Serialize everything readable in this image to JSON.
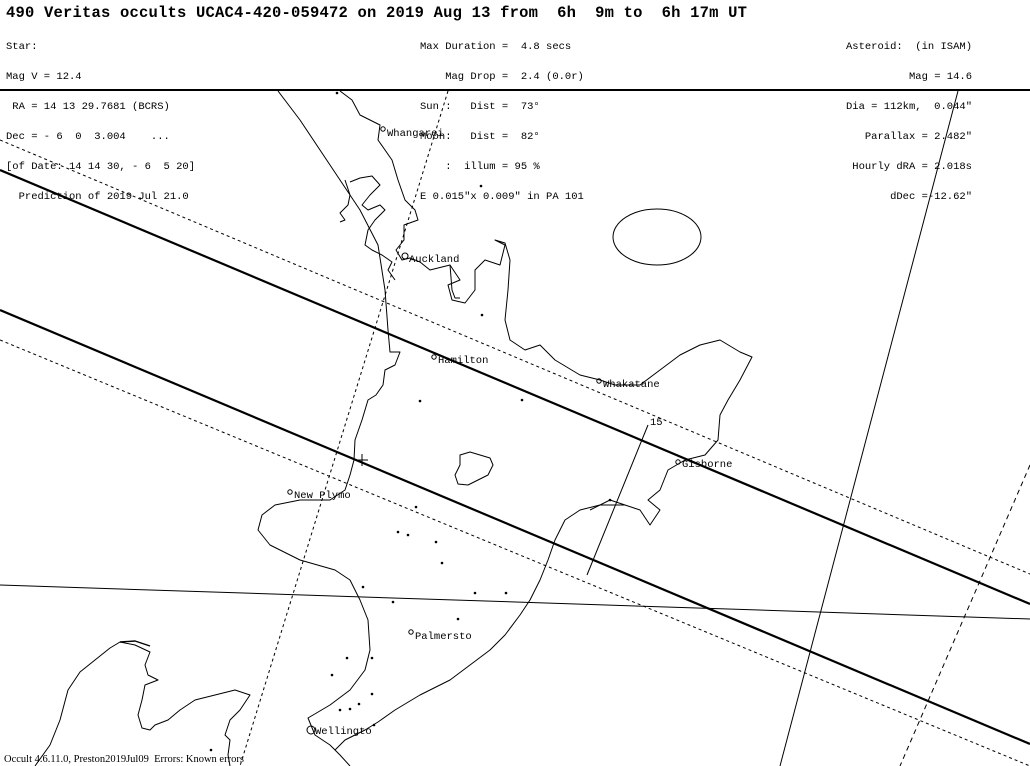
{
  "title": "490 Veritas occults UCAC4-420-059472 on 2019 Aug 13 from  6h  9m to  6h 17m UT",
  "star_info": [
    "Star:",
    "Mag V = 12.4",
    " RA = 14 13 29.7681 (BCRS)",
    "Dec = - 6  0  3.004    ...",
    "[of Date: 14 14 30, - 6  5 20]",
    "  Prediction of 2019 Jul 21.0"
  ],
  "event_info": [
    "Max Duration =  4.8 secs",
    "    Mag Drop =  2.4 (0.0r)",
    "Sun :   Dist =  73°",
    "Moon:   Dist =  82°",
    "    :  illum = 95 %",
    "E 0.015\"x 0.009\" in PA 101"
  ],
  "asteroid_info": [
    "Asteroid:  (in ISAM)",
    "Mag = 14.6",
    "Dia = 112km,  0.044\"",
    "Parallax = 2.482\"",
    "Hourly dRA = 2.018s",
    "dDec =-12.62\""
  ],
  "footer": "Occult 4.6.11.0, Preston2019Jul09  Errors: Known errors",
  "map": {
    "cities": [
      {
        "name": "Whangarei"
      },
      {
        "name": "Auckland"
      },
      {
        "name": "Hamilton"
      },
      {
        "name": "Whakatane"
      },
      {
        "name": "Gisborne"
      },
      {
        "name": "New Plymo"
      },
      {
        "name": "Palmersto"
      },
      {
        "name": "Wellingto"
      }
    ],
    "time_tick_label": "15",
    "path_lines": [
      "northern-limit",
      "southern-limit",
      "northern-1sigma",
      "southern-1sigma"
    ]
  }
}
